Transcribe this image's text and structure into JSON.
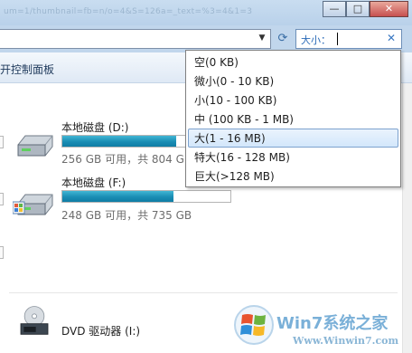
{
  "window": {
    "title_fragment": "um=1/thumbnail=fb=n/o=4&S=126a=_text=%3=4&1=3",
    "minimize_symbol": "—",
    "maximize_symbol": "□",
    "close_symbol": "✕"
  },
  "address": {
    "dropdown_symbol": "▼",
    "refresh_symbol": "⟳"
  },
  "search": {
    "label": "大小：",
    "clear_symbol": "✕"
  },
  "toolbar": {
    "control_panel_label": "开控制面板"
  },
  "drives": [
    {
      "name": "本地磁盘 (D:)",
      "info": "256 GB 可用，共 804 GB",
      "used_fraction": 0.68
    },
    {
      "name": "本地磁盘 (F:)",
      "info": "248 GB 可用，共 735 GB",
      "used_fraction": 0.66
    },
    {
      "name": "DVD 驱动器 (I:)"
    }
  ],
  "size_filter_menu": [
    {
      "label": "空(0 KB)"
    },
    {
      "label": "微小(0 - 10 KB)"
    },
    {
      "label": "小(10 - 100 KB)"
    },
    {
      "label": "中 (100 KB - 1 MB)"
    },
    {
      "label": "大(1 - 16 MB)",
      "selected": true
    },
    {
      "label": "特大(16 - 128 MB)"
    },
    {
      "label": "巨大(>128 MB)"
    }
  ],
  "watermark": {
    "brand": "Win7系统之家",
    "url": "Www.Winwin7.com"
  },
  "colors": {
    "accent": "#3a78c2",
    "usage_bar": "#1a8db4",
    "selection_border": "#7da2ce",
    "frame": "#c1d6ec"
  }
}
